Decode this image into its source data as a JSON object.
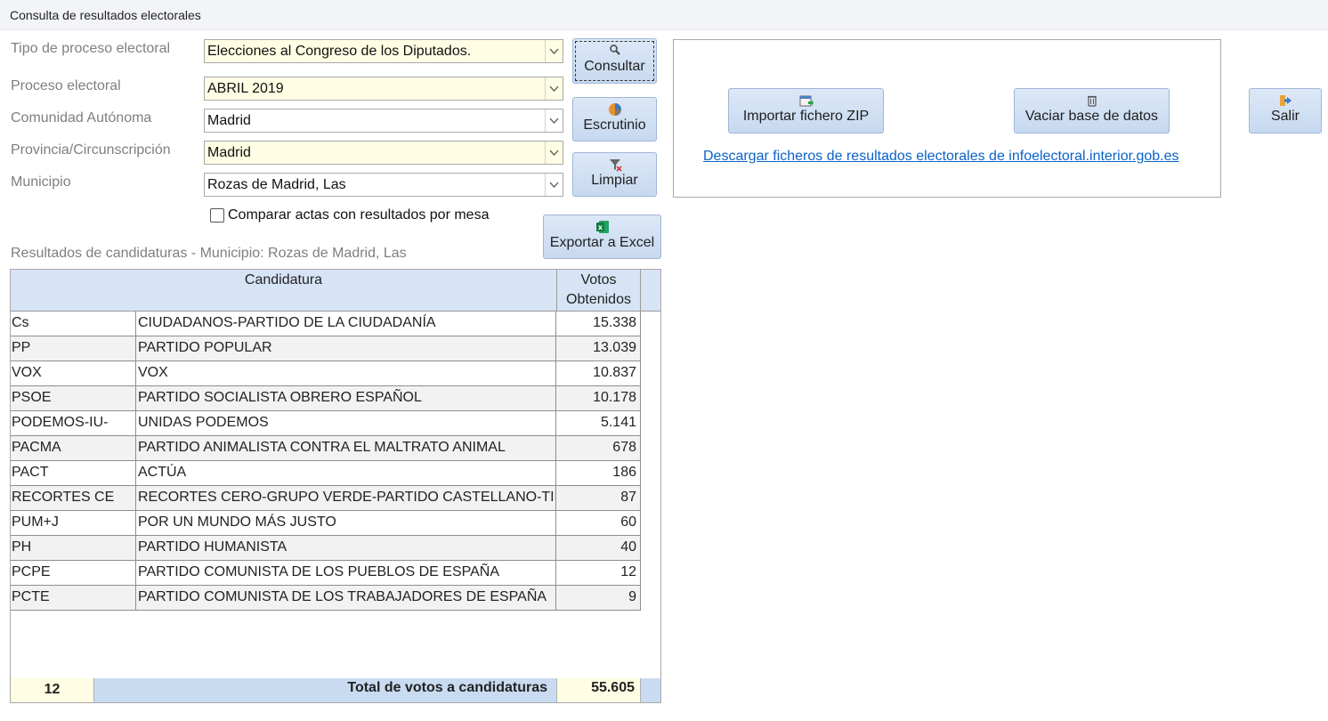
{
  "window": {
    "title": "Consulta de resultados electorales"
  },
  "filters": {
    "tipo_label": "Tipo de proceso electoral",
    "tipo_value": "Elecciones al Congreso de los Diputados.",
    "proceso_label": "Proceso electoral",
    "proceso_value": "ABRIL 2019",
    "comunidad_label": "Comunidad Autónoma",
    "comunidad_value": "Madrid",
    "provincia_label": "Provincia/Circunscripción",
    "provincia_value": "Madrid",
    "municipio_label": "Municipio",
    "municipio_value": "Rozas de Madrid, Las",
    "compare_label": "Comparar actas con resultados por mesa",
    "compare_checked": false
  },
  "buttons": {
    "consultar": "Consultar",
    "escrutinio": "Escrutinio",
    "limpiar": "Limpiar",
    "exportar": "Exportar a Excel",
    "importar": "Importar fichero ZIP",
    "vaciar": "Vaciar base de datos",
    "salir": "Salir"
  },
  "panel": {
    "download_link": "Descargar ficheros de resultados electorales de infoelectoral.interior.gob.es"
  },
  "results": {
    "section_title": "Resultados de candidaturas - Municipio: Rozas de Madrid, Las",
    "col_candidatura": "Candidatura",
    "col_votos": "Votos Obtenidos",
    "rows": [
      {
        "sigla": "Cs",
        "nombre": "CIUDADANOS-PARTIDO DE LA CIUDADANÍA",
        "votos": "15.338"
      },
      {
        "sigla": "PP",
        "nombre": "PARTIDO POPULAR",
        "votos": "13.039"
      },
      {
        "sigla": "VOX",
        "nombre": "VOX",
        "votos": "10.837"
      },
      {
        "sigla": "PSOE",
        "nombre": "PARTIDO SOCIALISTA OBRERO ESPAÑOL",
        "votos": "10.178"
      },
      {
        "sigla": "PODEMOS-IU-",
        "nombre": "UNIDAS PODEMOS",
        "votos": "5.141"
      },
      {
        "sigla": "PACMA",
        "nombre": "PARTIDO ANIMALISTA CONTRA EL MALTRATO ANIMAL",
        "votos": "678"
      },
      {
        "sigla": "PACT",
        "nombre": "ACTÚA",
        "votos": "186"
      },
      {
        "sigla": "RECORTES CE",
        "nombre": "RECORTES CERO-GRUPO VERDE-PARTIDO CASTELLANO-TIERR",
        "votos": "87"
      },
      {
        "sigla": "PUM+J",
        "nombre": "POR UN MUNDO MÁS JUSTO",
        "votos": "60"
      },
      {
        "sigla": "PH",
        "nombre": "PARTIDO HUMANISTA",
        "votos": "40"
      },
      {
        "sigla": "PCPE",
        "nombre": "PARTIDO COMUNISTA DE LOS PUEBLOS DE ESPAÑA",
        "votos": "12"
      },
      {
        "sigla": "PCTE",
        "nombre": "PARTIDO COMUNISTA DE LOS TRABAJADORES DE ESPAÑA",
        "votos": "9"
      }
    ],
    "footer_count": "12",
    "footer_label": "Total de votos a candidaturas",
    "footer_total": "55.605"
  },
  "colors": {
    "field_highlight": "#fffde3",
    "header_blue": "#d6e4f5",
    "link": "#0b62c8"
  },
  "icons": [
    "search-icon",
    "pie-chart-icon",
    "clear-filter-icon",
    "excel-icon",
    "import-zip-icon",
    "trash-icon",
    "exit-icon",
    "chevron-down-icon"
  ]
}
